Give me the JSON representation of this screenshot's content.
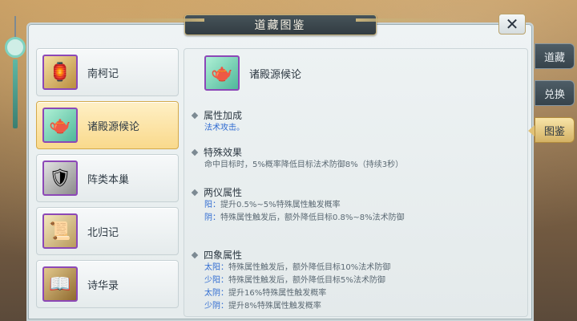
{
  "window": {
    "title": "道藏图鉴",
    "close_label": "✕"
  },
  "side_tabs": [
    {
      "label": "道藏",
      "active": false
    },
    {
      "label": "兑换",
      "active": false
    },
    {
      "label": "图鉴",
      "active": true
    }
  ],
  "list": [
    {
      "label": "南柯记",
      "icon": "golden-gourd-icon",
      "style": "gold",
      "glyph": "🏮",
      "selected": false
    },
    {
      "label": "诸殿源候论",
      "icon": "jade-gourd-icon",
      "style": "jade",
      "glyph": "🫖",
      "selected": true
    },
    {
      "label": "阵类本巢",
      "icon": "silver-talisman-icon",
      "style": "grey",
      "glyph": "🛡",
      "selected": false
    },
    {
      "label": "北归记",
      "icon": "scroll-icon",
      "style": "scroll",
      "glyph": "📜",
      "selected": false
    },
    {
      "label": "诗华录",
      "icon": "book-icon",
      "style": "book",
      "glyph": "📖",
      "selected": false
    }
  ],
  "detail": {
    "name": "诸殿源候论",
    "icon": "jade-gourd-icon",
    "sections": [
      {
        "title": "属性加成",
        "lines": [
          {
            "prefix": "",
            "text": "法术攻击。",
            "color": "blue"
          }
        ]
      },
      {
        "title": "特殊效果",
        "lines": [
          {
            "prefix": "",
            "text": "命中目标时，5%概率降低目标法术防御8%（持续3秒）",
            "color": "grey"
          }
        ]
      },
      {
        "title": "两仪属性",
        "lines": [
          {
            "prefix": "阳：",
            "text": "提升0.5%~5%特殊属性触发概率",
            "color": "grey"
          },
          {
            "prefix": "阴：",
            "text": "特殊属性触发后，额外降低目标0.8%~8%法术防御",
            "color": "grey"
          }
        ]
      },
      {
        "title": "四象属性",
        "lines": [
          {
            "prefix": "太阳：",
            "text": "特殊属性触发后，额外降低目标10%法术防御",
            "color": "grey"
          },
          {
            "prefix": "少阳：",
            "text": "特殊属性触发后，额外降低目标5%法术防御",
            "color": "grey"
          },
          {
            "prefix": "太阴：",
            "text": "提升16%特殊属性触发概率",
            "color": "grey"
          },
          {
            "prefix": "少阴：",
            "text": "提升8%特殊属性触发概率",
            "color": "grey"
          }
        ]
      }
    ]
  },
  "colors": {
    "accent_blue": "#2f6bd1",
    "selected_bg": "#f9d98c",
    "icon_border": "#8c48b7"
  }
}
